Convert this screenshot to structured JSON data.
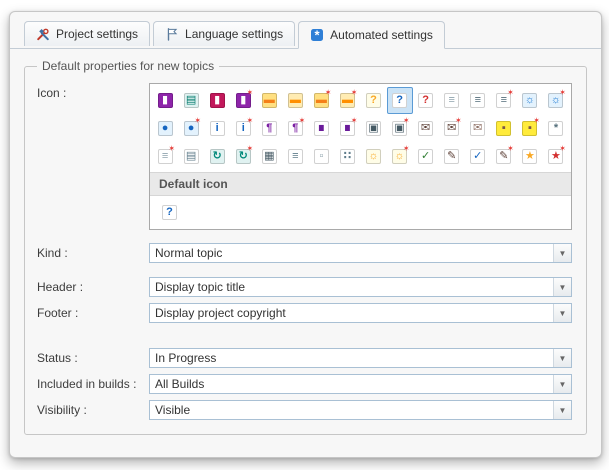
{
  "theme": {
    "selection_bg": "#cbe3f6",
    "selection_border": "#5b9bd5",
    "new_star_color": "#e53935",
    "tab_accent": "#2f7fd6"
  },
  "tabs": [
    {
      "label": "Project settings",
      "icon": "tools-icon",
      "active": false
    },
    {
      "label": "Language settings",
      "icon": "flag-icon",
      "active": false
    },
    {
      "label": "Automated settings",
      "icon": "automation-icon",
      "active": true
    }
  ],
  "group": {
    "title": "Default properties for new topics"
  },
  "fields": {
    "icon": {
      "label": "Icon :"
    },
    "kind": {
      "label": "Kind :",
      "value": "Normal topic"
    },
    "header": {
      "label": "Header :",
      "value": "Display topic title"
    },
    "footer": {
      "label": "Footer :",
      "value": "Display project copyright"
    },
    "status": {
      "label": "Status :",
      "value": "In Progress"
    },
    "builds": {
      "label": "Included in builds :",
      "value": "All Builds"
    },
    "visibility": {
      "label": "Visibility :",
      "value": "Visible"
    }
  },
  "icon_picker": {
    "default_header": "Default icon",
    "selected": {
      "row": 0,
      "col": 9
    },
    "default_icon": {
      "name": "default-help",
      "glyph": "?",
      "fg": "#1565c0",
      "bg": "#ffffff"
    },
    "rows": [
      [
        {
          "name": "purple-book",
          "glyph": "▮",
          "fg": "#ffffff",
          "bg": "#8e24aa"
        },
        {
          "name": "open-book",
          "glyph": "▤",
          "fg": "#00796b",
          "bg": "#e0f2f1"
        },
        {
          "name": "pink-book",
          "glyph": "▮",
          "fg": "#ffffff",
          "bg": "#c2185b"
        },
        {
          "name": "new-book",
          "glyph": "▮",
          "fg": "#ffffff",
          "bg": "#8e24aa",
          "star": true
        },
        {
          "name": "folder",
          "glyph": "▬",
          "fg": "#f57f17",
          "bg": "#ffe082"
        },
        {
          "name": "open-folder",
          "glyph": "▬",
          "fg": "#ff8f00",
          "bg": "#ffecb3"
        },
        {
          "name": "new-folder",
          "glyph": "▬",
          "fg": "#f57f17",
          "bg": "#ffe082",
          "star": true
        },
        {
          "name": "new-open-folder",
          "glyph": "▬",
          "fg": "#ff8f00",
          "bg": "#ffecb3",
          "star": true
        },
        {
          "name": "help-topic-yellow",
          "glyph": "?",
          "fg": "#f9a825",
          "bg": "#fffde7"
        },
        {
          "name": "help-topic-blue",
          "glyph": "?",
          "fg": "#1565c0",
          "bg": "#ffffff"
        },
        {
          "name": "help-topic-red",
          "glyph": "?",
          "fg": "#d32f2f",
          "bg": "#ffffff"
        },
        {
          "name": "page",
          "glyph": "≡",
          "fg": "#90a4ae",
          "bg": "#ffffff"
        },
        {
          "name": "page-text",
          "glyph": "≡",
          "fg": "#546e7a",
          "bg": "#ffffff"
        },
        {
          "name": "new-page",
          "glyph": "≡",
          "fg": "#546e7a",
          "bg": "#ffffff",
          "star": true
        },
        {
          "name": "web-topic",
          "glyph": "☼",
          "fg": "#1976d2",
          "bg": "#e3f2fd"
        },
        {
          "name": "new-web-topic",
          "glyph": "☼",
          "fg": "#1976d2",
          "bg": "#e3f2fd",
          "star": true
        }
      ],
      [
        {
          "name": "target",
          "glyph": "●",
          "fg": "#1565c0",
          "bg": "#e3f2fd"
        },
        {
          "name": "new-target",
          "glyph": "●",
          "fg": "#1565c0",
          "bg": "#e3f2fd",
          "star": true
        },
        {
          "name": "info",
          "glyph": "i",
          "fg": "#1565c0",
          "bg": "#ffffff"
        },
        {
          "name": "new-info",
          "glyph": "i",
          "fg": "#1565c0",
          "bg": "#ffffff",
          "star": true
        },
        {
          "name": "note",
          "glyph": "¶",
          "fg": "#7b1fa2",
          "bg": "#ffffff"
        },
        {
          "name": "new-note",
          "glyph": "¶",
          "fg": "#7b1fa2",
          "bg": "#ffffff",
          "star": true
        },
        {
          "name": "bookmark",
          "glyph": "∎",
          "fg": "#6a1b9a",
          "bg": "#ffffff"
        },
        {
          "name": "new-bookmark",
          "glyph": "∎",
          "fg": "#6a1b9a",
          "bg": "#ffffff",
          "star": true
        },
        {
          "name": "screen",
          "glyph": "▣",
          "fg": "#455a64",
          "bg": "#ffffff"
        },
        {
          "name": "new-screen",
          "glyph": "▣",
          "fg": "#455a64",
          "bg": "#ffffff",
          "star": true
        },
        {
          "name": "mail",
          "glyph": "✉",
          "fg": "#5d4037",
          "bg": "#ffffff"
        },
        {
          "name": "new-mail",
          "glyph": "✉",
          "fg": "#5d4037",
          "bg": "#ffffff",
          "star": true
        },
        {
          "name": "sent-mail",
          "glyph": "✉",
          "fg": "#8d6e63",
          "bg": "#ffffff"
        },
        {
          "name": "lock",
          "glyph": "▪",
          "fg": "#795548",
          "bg": "#ffeb3b"
        },
        {
          "name": "new-lock",
          "glyph": "▪",
          "fg": "#795548",
          "bg": "#ffeb3b",
          "star": true
        },
        {
          "name": "gear",
          "glyph": "*",
          "fg": "#546e7a",
          "bg": "#ffffff"
        }
      ],
      [
        {
          "name": "new-topic",
          "glyph": "≡",
          "fg": "#90a4ae",
          "bg": "#ffffff",
          "star": true
        },
        {
          "name": "copy-pages",
          "glyph": "▤",
          "fg": "#607d8b",
          "bg": "#ffffff"
        },
        {
          "name": "refresh",
          "glyph": "↻",
          "fg": "#00897b",
          "bg": "#e0f2f1"
        },
        {
          "name": "new-refresh",
          "glyph": "↻",
          "fg": "#00897b",
          "bg": "#e0f2f1",
          "star": true
        },
        {
          "name": "printer",
          "glyph": "▦",
          "fg": "#455a64",
          "bg": "#ffffff"
        },
        {
          "name": "pages-stack",
          "glyph": "≡",
          "fg": "#607d8b",
          "bg": "#ffffff"
        },
        {
          "name": "small-page",
          "glyph": "▫",
          "fg": "#90a4ae",
          "bg": "#ffffff"
        },
        {
          "name": "snippet",
          "glyph": "∷",
          "fg": "#607d8b",
          "bg": "#ffffff"
        },
        {
          "name": "idea",
          "glyph": "☼",
          "fg": "#f9a825",
          "bg": "#fffde7"
        },
        {
          "name": "new-idea",
          "glyph": "☼",
          "fg": "#f9a825",
          "bg": "#fffde7",
          "star": true
        },
        {
          "name": "check-page",
          "glyph": "✓",
          "fg": "#2e7d32",
          "bg": "#ffffff"
        },
        {
          "name": "edit-page",
          "glyph": "✎",
          "fg": "#5d4037",
          "bg": "#ffffff"
        },
        {
          "name": "approved-page",
          "glyph": "✓",
          "fg": "#1565c0",
          "bg": "#ffffff"
        },
        {
          "name": "new-edit-page",
          "glyph": "✎",
          "fg": "#5d4037",
          "bg": "#ffffff",
          "star": true
        },
        {
          "name": "star-page",
          "glyph": "★",
          "fg": "#f9a825",
          "bg": "#ffffff"
        },
        {
          "name": "new-special",
          "glyph": "★",
          "fg": "#d32f2f",
          "bg": "#ffffff",
          "star": true
        }
      ]
    ]
  }
}
